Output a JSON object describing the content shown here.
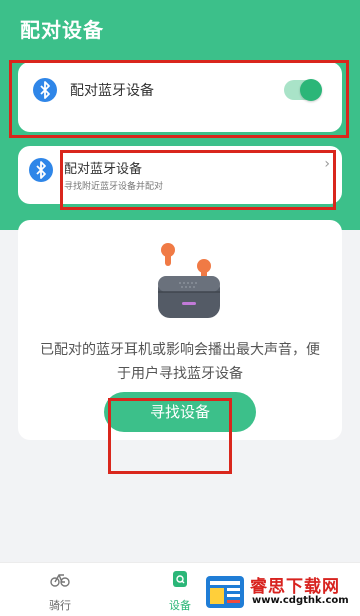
{
  "header": {
    "title": "配对设备",
    "background_color": "#3cc08a"
  },
  "bluetooth_toggle": {
    "icon": "bluetooth-icon",
    "label": "配对蓝牙设备",
    "enabled": true
  },
  "pair_device": {
    "icon": "bluetooth-icon",
    "title": "配对蓝牙设备",
    "subtitle": "寻找附近蓝牙设备并配对",
    "chevron": "›"
  },
  "find_panel": {
    "image": "earbuds-case-image",
    "description": "已配对的蓝牙耳机或影响会播出最大声音，便于用户寻找蓝牙设备",
    "button_label": "寻找设备"
  },
  "tabbar": {
    "tabs": [
      {
        "label": "骑行",
        "icon": "bicycle-icon",
        "active": false
      },
      {
        "label": "设备",
        "icon": "device-icon",
        "active": true
      }
    ]
  },
  "watermark": {
    "name": "睿思下载网",
    "url": "www.cdgthk.com"
  },
  "colors": {
    "accent": "#3cc08a",
    "annotation_red": "#d9261c",
    "background": "#f2f3f5"
  }
}
